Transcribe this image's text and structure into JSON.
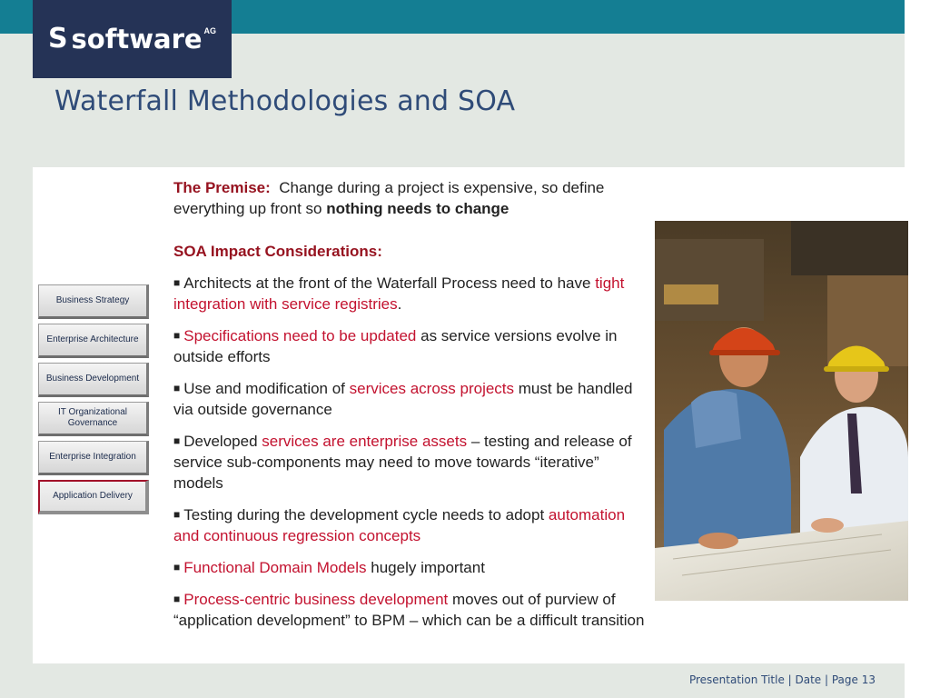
{
  "logo": {
    "mark": "S",
    "word": "software",
    "suffix": "AG"
  },
  "title": "Waterfall Methodologies and SOA",
  "stages": [
    {
      "label": "Business Strategy",
      "active": false
    },
    {
      "label": "Enterprise Architecture",
      "active": false
    },
    {
      "label": "Business Development",
      "active": false
    },
    {
      "label": "IT Organizational Governance",
      "active": false
    },
    {
      "label": "Enterprise Integration",
      "active": false
    },
    {
      "label": "Application Delivery",
      "active": true
    }
  ],
  "premise": {
    "label": "The Premise:",
    "text": "Change during a project is expensive, so define everything up front so",
    "emphasis": "nothing needs to change"
  },
  "soa_heading": "SOA Impact Considerations:",
  "bullets": [
    {
      "pre": "Architects at the front of the Waterfall Process need to have",
      "red": "tight integration with service registries",
      "post": "."
    },
    {
      "pre": "",
      "red": "Specifications need to be updated",
      "post": "as service versions evolve in outside efforts"
    },
    {
      "pre": "Use and modification of",
      "red": "services across projects",
      "post": "must be handled via outside governance"
    },
    {
      "pre": "Developed",
      "red": "services are enterprise assets",
      "post": "– testing and release of service sub-components may need to move towards “iterative” models"
    },
    {
      "pre": "Testing during the development cycle needs to adopt",
      "red": "automation and continuous regression concepts",
      "post": ""
    },
    {
      "pre": "",
      "red": "Functional Domain Models",
      "post": "hugely important"
    },
    {
      "pre": "",
      "red": "Process-centric business development",
      "post": "moves out of purview of “application development” to BPM – which can be a difficult transition"
    }
  ],
  "footer": "Presentation Title | Date | Page 13",
  "colors": {
    "band": "#147e93",
    "logo_bg": "#253356",
    "title": "#2f4b78",
    "accent_red": "#c3122f"
  }
}
